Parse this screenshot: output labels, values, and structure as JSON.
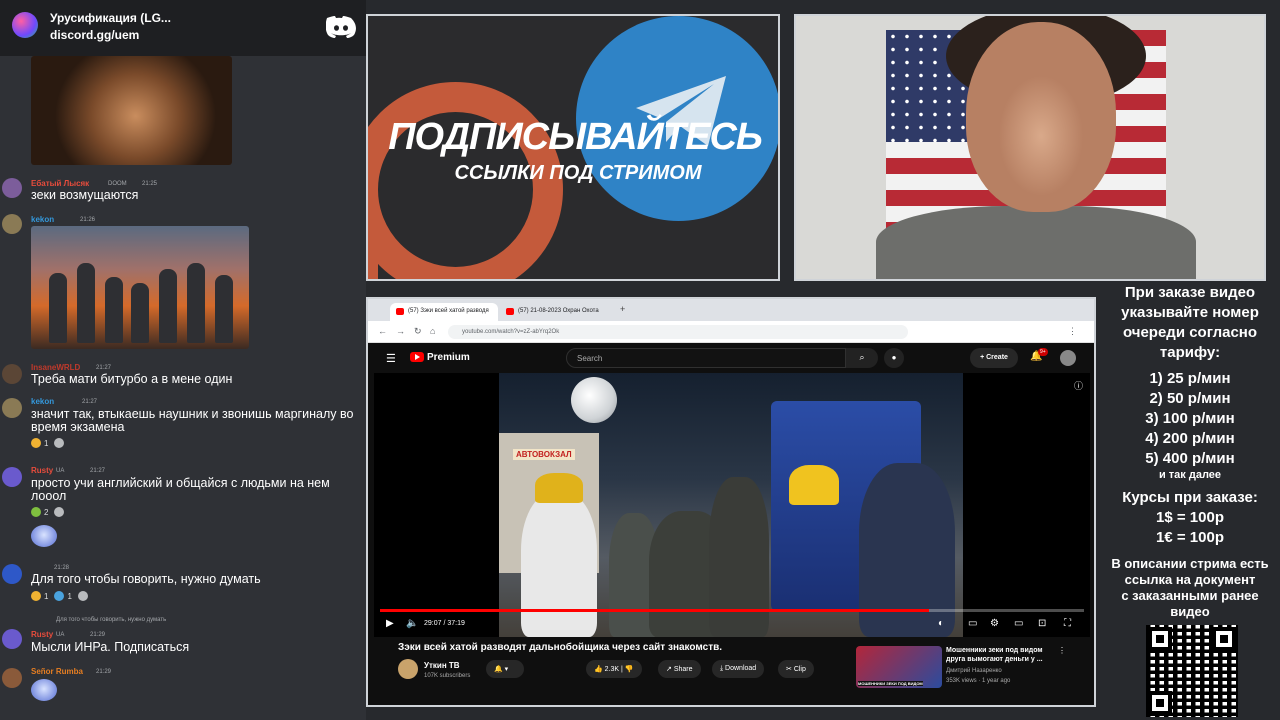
{
  "discord": {
    "server_name": "Урусификация (LG...",
    "invite": "discord.gg/uem",
    "messages": [
      {
        "user": "Ебатый Лысяк",
        "badge": "DOOM",
        "time": "21:25",
        "text": "зеки возмущаются",
        "color": "#e74c3c"
      },
      {
        "user": "kekon",
        "badge": "",
        "time": "21:26",
        "text": "",
        "color": "#3498db"
      },
      {
        "user": "InsaneWRLD",
        "badge": "",
        "time": "21:27",
        "text": "Треба мати битурбо а в мене один",
        "color": "#c0392b"
      },
      {
        "user": "kekon",
        "badge": "",
        "time": "21:27",
        "text": "значит так, втыкаешь наушник и звонишь маргиналу во время экзамена",
        "color": "#3498db"
      },
      {
        "user": "Rusty",
        "badge": "UA",
        "time": "21:27",
        "text": "просто учи английский и общайся с людьми на нем лооол",
        "color": "#e74c3c"
      },
      {
        "user": "",
        "badge": "",
        "time": "21:28",
        "text": "Для того чтобы говорить, нужно думать",
        "color": "#f1c40f"
      },
      {
        "user": "Rusty",
        "badge": "UA",
        "time": "21:29",
        "text": "Мысли ИНРа. Подписаться",
        "color": "#e74c3c",
        "reply": "Для того чтобы говорить, нужно думать"
      },
      {
        "user": "Señor Rumba",
        "badge": "",
        "time": "21:29",
        "text": "",
        "color": "#e67e22"
      }
    ],
    "reactions": {
      "msg4": [
        {
          "count": "1"
        },
        {
          "count": ""
        }
      ],
      "msg5": [
        {
          "count": "2"
        },
        {
          "count": ""
        }
      ],
      "msg6": [
        {
          "count": "1"
        },
        {
          "count": "1"
        },
        {
          "count": ""
        }
      ]
    }
  },
  "banner": {
    "title": "ПОДПИСЫВАЙТЕСЬ",
    "subtitle": "ССЫЛКИ ПОД СТРИМОМ"
  },
  "browser": {
    "tab1": "(57) Зэки всей хатой разводя",
    "tab2": "(57) 21-08-2023 Охран Охота",
    "url": "youtube.com/watch?v=zZ-abYrq2Ok"
  },
  "youtube": {
    "premium": "Premium",
    "search_placeholder": "Search",
    "create": "Create",
    "notif_badge": "9+",
    "time": "29:07 / 37:19",
    "progress_fraction": 0.78,
    "station_sign": "АВТОВОКЗАЛ",
    "video_title": "Зэки всей хатой разводят дальнобойщика через сайт знакомств.",
    "channel": "Уткин ТВ",
    "subscribers": "107K subscribers",
    "likes": "2.3K",
    "share": "Share",
    "download": "Download",
    "clip": "Clip",
    "rec_title": "Мошенники зеки под видом друга вымогают деньги у ...",
    "rec_channel": "Дмитрий Назаренко",
    "rec_meta": "353K views · 1 year ago",
    "rec_thumb_text": "МОШЕННИКИ ЗЕКИ ПОД ВИДОМ"
  },
  "prices": {
    "intro": [
      "При заказе видео",
      "указывайте номер",
      "очереди согласно",
      "тарифу:"
    ],
    "tiers": [
      "1) 25 р/мин",
      "2) 50 р/мин",
      "3) 100 р/мин",
      "4) 200 р/мин",
      "5) 400 р/мин"
    ],
    "etc": "и так далее",
    "rates_title": "Курсы при заказе:",
    "rates": [
      "1$ = 100р",
      "1€ = 100р"
    ],
    "outro": [
      "В описании стрима есть",
      "ссылка на документ",
      "с заказанными ранее",
      "видео"
    ]
  },
  "colors": {
    "youtube_red": "#ff0000",
    "telegram_blue": "#2f83c6",
    "patreon_orange": "#c45a3b",
    "discord_bg": "#2f3136"
  }
}
